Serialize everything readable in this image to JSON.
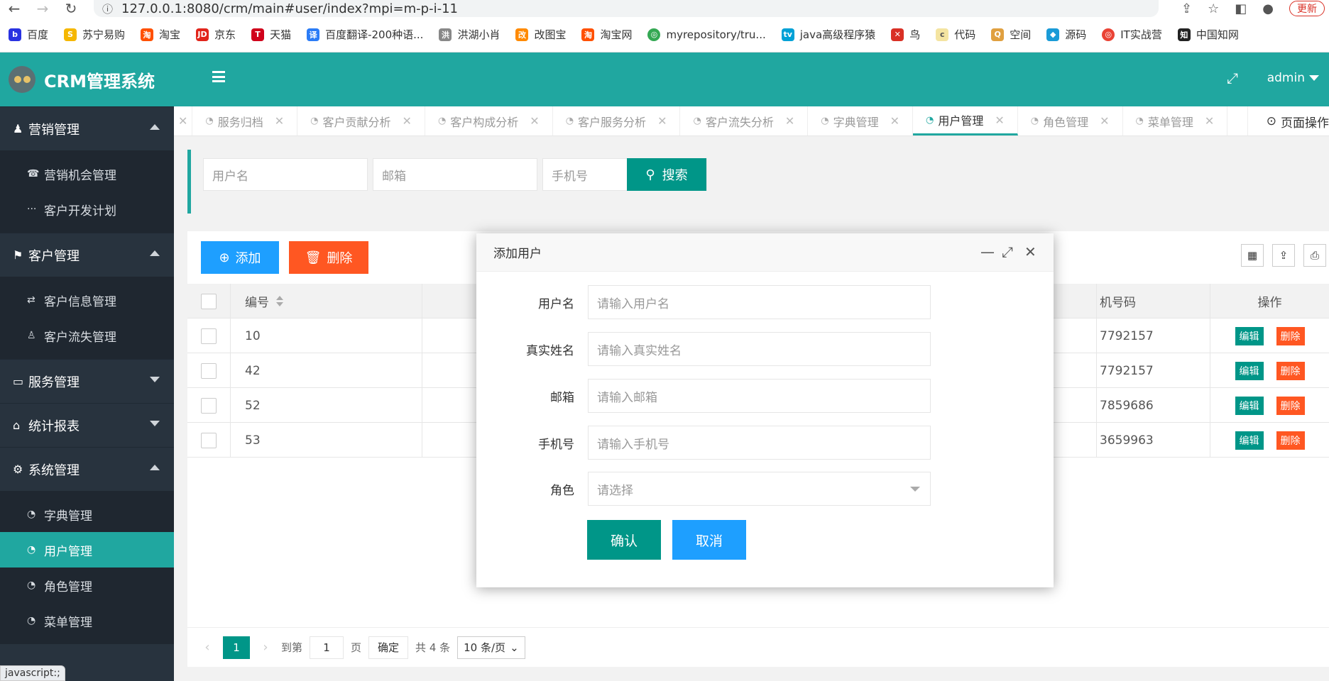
{
  "browser": {
    "url": "127.0.0.1:8080/crm/main#user/index?mpi=m-p-i-11",
    "update_label": "更新",
    "bookmarks": [
      "百度",
      "苏宁易购",
      "淘宝",
      "京东",
      "天猫",
      "百度翻译-200种语...",
      "洪湖小肖",
      "改图宝",
      "淘宝网",
      "myrepository/tru...",
      "java高级程序猿",
      "鸟",
      "代码",
      "空间",
      "源码",
      "IT实战营",
      "中国知网"
    ]
  },
  "app": {
    "title": "CRM管理系统",
    "user": "admin"
  },
  "sidebar": {
    "groups": [
      {
        "label": "营销管理",
        "items": [
          "营销机会管理",
          "客户开发计划"
        ]
      },
      {
        "label": "客户管理",
        "items": [
          "客户信息管理",
          "客户流失管理"
        ]
      },
      {
        "label": "服务管理",
        "items": []
      },
      {
        "label": "统计报表",
        "items": []
      },
      {
        "label": "系统管理",
        "items": [
          "字典管理",
          "用户管理",
          "角色管理",
          "菜单管理"
        ]
      }
    ]
  },
  "tabs": {
    "items": [
      "服务归档",
      "客户贡献分析",
      "客户构成分析",
      "客户服务分析",
      "客户流失分析",
      "字典管理",
      "用户管理",
      "角色管理",
      "菜单管理"
    ],
    "active": "用户管理",
    "page_ops": "页面操作"
  },
  "search": {
    "username_placeholder": "用户名",
    "email_placeholder": "邮箱",
    "phone_placeholder": "手机号",
    "button": "搜索"
  },
  "toolbar": {
    "add": "添加",
    "delete": "删除"
  },
  "table": {
    "headers": {
      "id": "编号",
      "phone": "机号码",
      "ops": "操作"
    },
    "rows": [
      {
        "id": "10",
        "phone": "7792157"
      },
      {
        "id": "42",
        "phone": "7792157"
      },
      {
        "id": "52",
        "phone": "7859686"
      },
      {
        "id": "53",
        "phone": "3659963"
      }
    ],
    "edit_label": "编辑",
    "delete_label": "删除"
  },
  "pager": {
    "current": "1",
    "goto_label": "到第",
    "goto_value": "1",
    "page_unit": "页",
    "confirm": "确定",
    "total": "共 4 条",
    "page_size": "10 条/页"
  },
  "modal": {
    "title": "添加用户",
    "fields": [
      {
        "label": "用户名",
        "placeholder": "请输入用户名"
      },
      {
        "label": "真实姓名",
        "placeholder": "请输入真实姓名"
      },
      {
        "label": "邮箱",
        "placeholder": "请输入邮箱"
      },
      {
        "label": "手机号",
        "placeholder": "请输入手机号"
      },
      {
        "label": "角色",
        "placeholder": "请选择"
      }
    ],
    "confirm": "确认",
    "cancel": "取消"
  },
  "status": "javascript:;",
  "colors": {
    "primary": "#009688",
    "header": "#20a7a0",
    "blue": "#1e9fff",
    "danger": "#ff5722",
    "sidebar": "#28333e"
  }
}
